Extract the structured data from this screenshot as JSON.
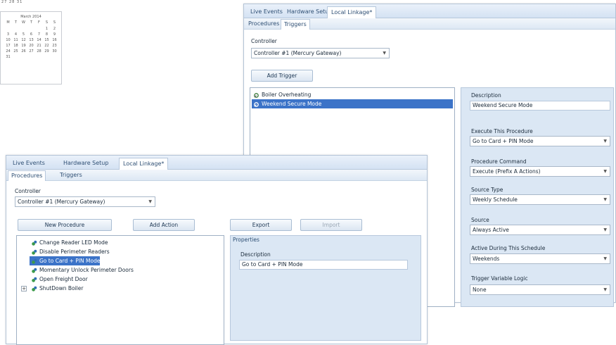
{
  "calendar": {
    "top_row": "27 28 31",
    "month_label": "March 2014",
    "day_headers": [
      "M",
      "T",
      "W",
      "T",
      "F",
      "S",
      "S"
    ],
    "days": [
      "",
      "",
      "",
      "",
      "",
      "1",
      "2",
      "3",
      "4",
      "5",
      "6",
      "7",
      "8",
      "9",
      "10",
      "11",
      "12",
      "13",
      "14",
      "15",
      "16",
      "17",
      "18",
      "19",
      "20",
      "21",
      "22",
      "23",
      "24",
      "25",
      "26",
      "27",
      "28",
      "29",
      "30",
      "31",
      "",
      "",
      "",
      "",
      "",
      ""
    ]
  },
  "back_window": {
    "tabs": [
      "Live Events",
      "Hardware Setup",
      "Local Linkage*"
    ],
    "subtabs": [
      "Procedures",
      "Triggers"
    ],
    "controller_label": "Controller",
    "controller_value": "Controller #1 (Mercury Gateway)",
    "add_trigger_label": "Add Trigger",
    "triggers": [
      "Boiler Overheating",
      "Weekend Secure Mode"
    ],
    "details": [
      {
        "label": "Description",
        "value": "Weekend Secure Mode",
        "type": "text"
      },
      {
        "label": "Execute This Procedure",
        "value": "Go to Card + PIN Mode",
        "type": "dropdown"
      },
      {
        "label": "Procedure Command",
        "value": "Execute (Prefix A Actions)",
        "type": "dropdown"
      },
      {
        "label": "Source Type",
        "value": "Weekly Schedule",
        "type": "dropdown"
      },
      {
        "label": "Source",
        "value": "Always Active",
        "type": "dropdown"
      },
      {
        "label": "Active During This Schedule",
        "value": "Weekends",
        "type": "dropdown"
      },
      {
        "label": "Trigger Variable Logic",
        "value": "None",
        "type": "dropdown"
      }
    ]
  },
  "front_window": {
    "tabs": [
      "Live Events",
      "Hardware Setup",
      "Local Linkage*"
    ],
    "subtabs": [
      "Procedures",
      "Triggers"
    ],
    "controller_label": "Controller",
    "controller_value": "Controller #1 (Mercury Gateway)",
    "new_procedure_label": "New Procedure",
    "add_action_label": "Add Action",
    "export_label": "Export",
    "import_label": "Import",
    "procedures": [
      "Change Reader LED Mode",
      "Disable Perimeter Readers",
      "Go to Card + PIN Mode",
      "Momentary Unlock Perimeter Doors",
      "Open Freight Door",
      "ShutDown Boiler"
    ],
    "properties_title": "Properties",
    "description_label": "Description",
    "description_value": "Go to Card + PIN Mode"
  },
  "colors": {
    "selection": "#3b73c8",
    "tab_bar": "#d4e2f3",
    "properties_bg": "#dbe7f4"
  }
}
